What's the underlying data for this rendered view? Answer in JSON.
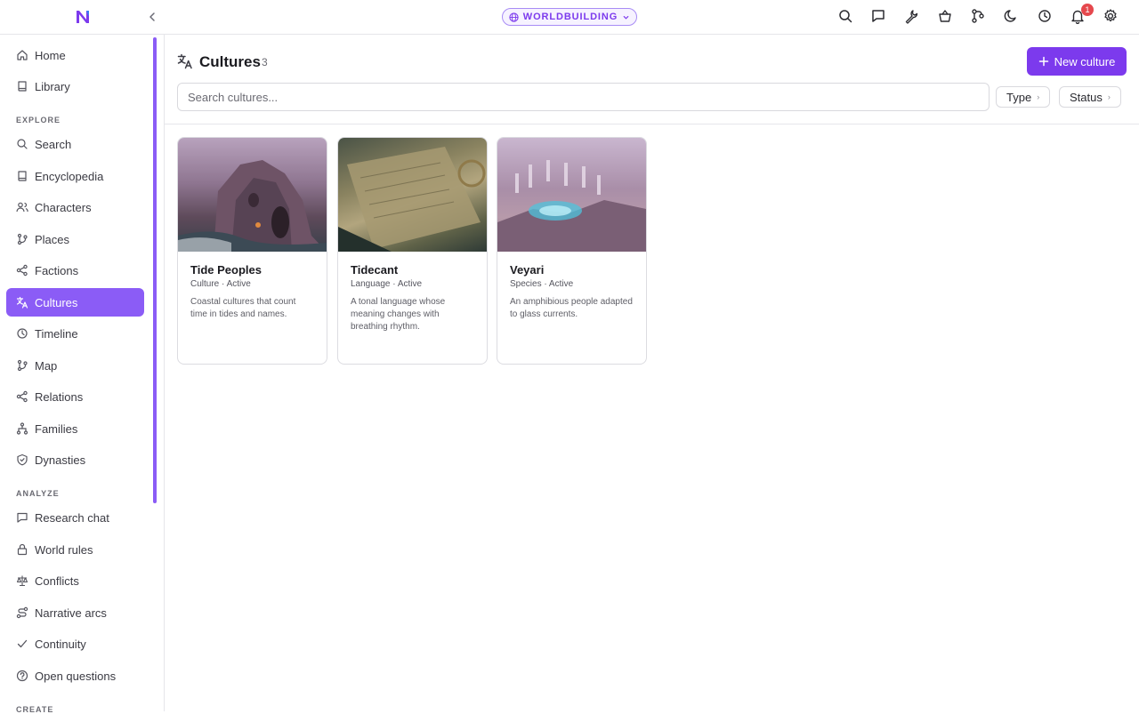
{
  "topbar": {
    "mode_label": "WORLDBUILDING",
    "notification_count": "1",
    "icons": [
      "search-icon",
      "chat-icon",
      "wrench-icon",
      "basket-icon",
      "git-branch-icon",
      "moon-icon",
      "clock-icon",
      "bell-icon",
      "gear-icon"
    ]
  },
  "sidebar": {
    "top_items": [
      {
        "label": "Home",
        "icon": "home-icon"
      },
      {
        "label": "Library",
        "icon": "book-icon"
      }
    ],
    "sections": [
      {
        "label": "EXPLORE",
        "items": [
          {
            "label": "Search",
            "icon": "search-icon"
          },
          {
            "label": "Encyclopedia",
            "icon": "book-icon"
          },
          {
            "label": "Characters",
            "icon": "users-icon"
          },
          {
            "label": "Places",
            "icon": "branch-icon"
          },
          {
            "label": "Factions",
            "icon": "share-icon"
          },
          {
            "label": "Cultures",
            "icon": "translate-icon",
            "active": true
          },
          {
            "label": "Timeline",
            "icon": "clock-icon"
          },
          {
            "label": "Map",
            "icon": "branch-icon"
          },
          {
            "label": "Relations",
            "icon": "share-icon"
          },
          {
            "label": "Families",
            "icon": "tree-icon"
          },
          {
            "label": "Dynasties",
            "icon": "shield-icon"
          }
        ]
      },
      {
        "label": "ANALYZE",
        "items": [
          {
            "label": "Research chat",
            "icon": "chat-icon"
          },
          {
            "label": "World rules",
            "icon": "lock-icon"
          },
          {
            "label": "Conflicts",
            "icon": "scale-icon"
          },
          {
            "label": "Narrative arcs",
            "icon": "route-icon"
          },
          {
            "label": "Continuity",
            "icon": "check-icon"
          },
          {
            "label": "Open questions",
            "icon": "help-icon"
          }
        ]
      },
      {
        "label": "CREATE",
        "items": []
      }
    ]
  },
  "main": {
    "title": "Cultures",
    "count": "3",
    "new_button_label": "New culture",
    "search_placeholder": "Search cultures...",
    "filters": [
      {
        "label": "Type"
      },
      {
        "label": "Status"
      }
    ],
    "cards": [
      {
        "name": "Tide Peoples",
        "meta": "Culture · Active",
        "description": "Coastal cultures that count time in tides and names."
      },
      {
        "name": "Tidecant",
        "meta": "Language · Active",
        "description": "A tonal language whose meaning changes with breathing rhythm."
      },
      {
        "name": "Veyari",
        "meta": "Species · Active",
        "description": "An amphibious people adapted to glass currents."
      }
    ]
  },
  "colors": {
    "accent": "#7c3aed",
    "accent_light": "#8b5cf6",
    "badge": "#e5484d"
  }
}
